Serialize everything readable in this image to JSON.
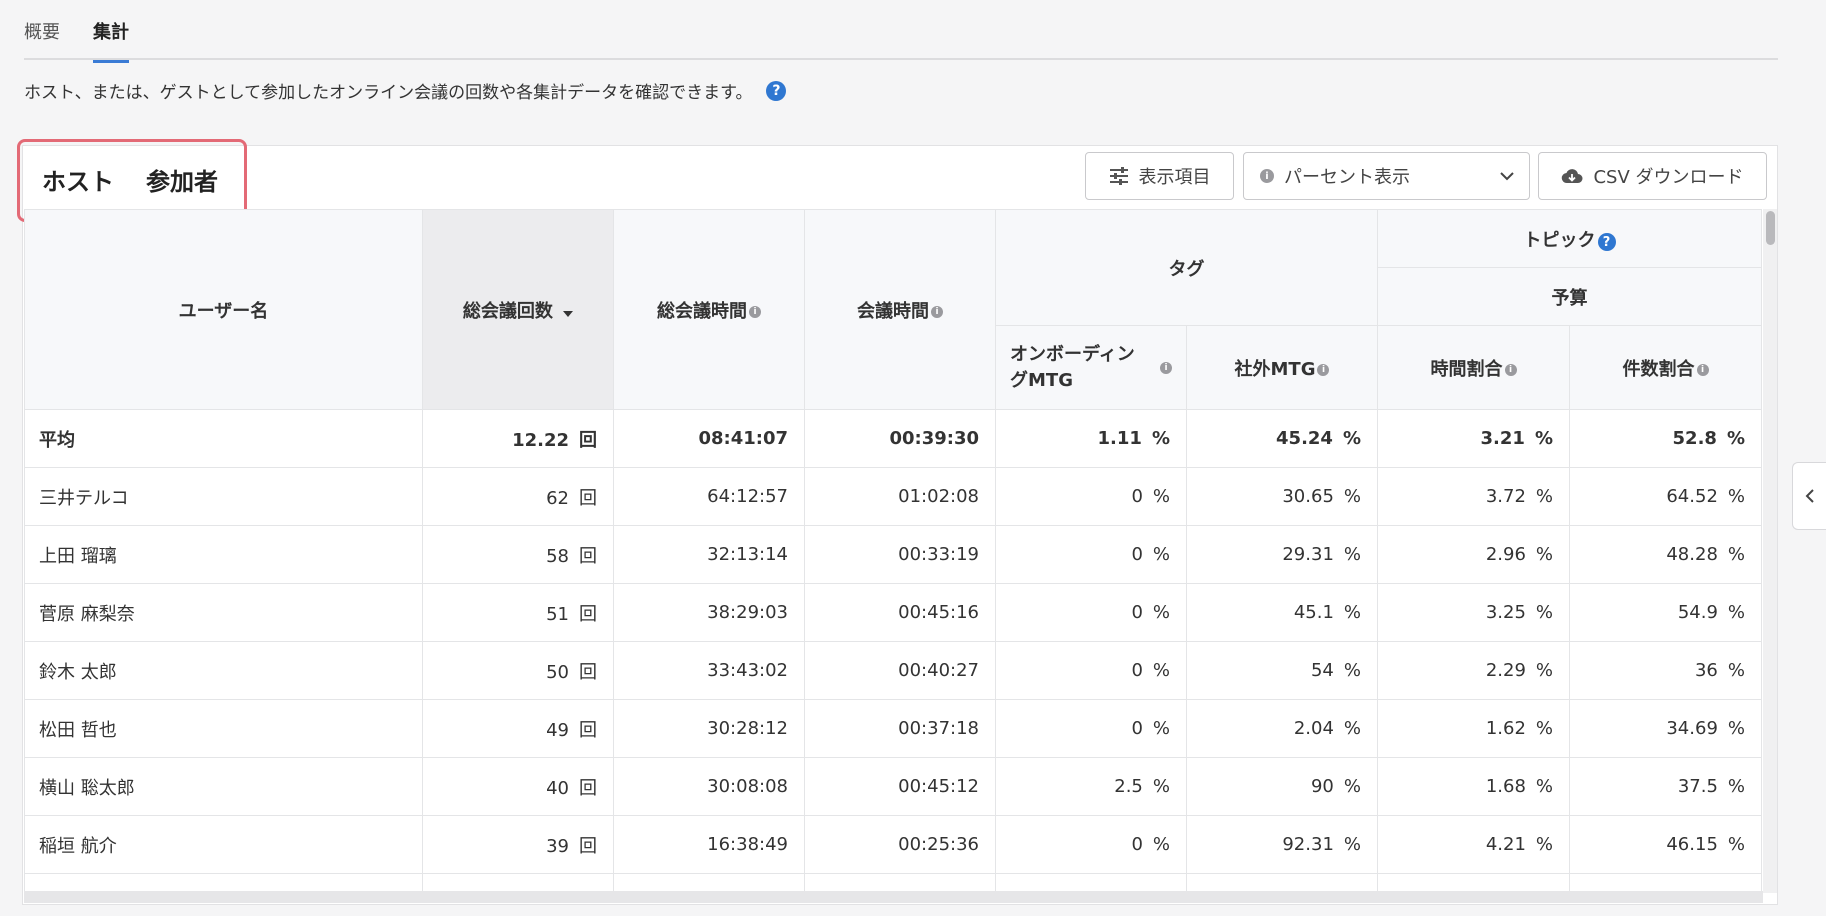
{
  "top_tabs": [
    {
      "label": "概要",
      "active": false
    },
    {
      "label": "集計",
      "active": true
    }
  ],
  "description": "ホスト、または、ゲストとして参加したオンライン会議の回数や各集計データを確認できます。",
  "help_symbol": "?",
  "info_symbol": "i",
  "sub_tabs": [
    {
      "label": "ホスト",
      "active": true
    },
    {
      "label": "参加者",
      "active": false
    }
  ],
  "toolbar": {
    "columns_label": "表示項目",
    "percent_select": "パーセント表示",
    "csv_label": "CSV ダウンロード"
  },
  "table": {
    "headers": {
      "user": "ユーザー名",
      "total_count": "総会議回数",
      "total_time": "総会議時間",
      "meeting_time": "会議時間",
      "tag_group": "タグ",
      "topic_group": "トピック",
      "budget_group": "予算",
      "onboarding": "オンボーディングMTG",
      "external": "社外MTG",
      "time_ratio": "時間割合",
      "count_ratio": "件数割合"
    },
    "count_unit": "回",
    "percent_unit": "%",
    "average": {
      "name": "平均",
      "count": "12.22",
      "total_time": "08:41:07",
      "meeting_time": "00:39:30",
      "onboarding": "1.11",
      "external": "45.24",
      "time_ratio": "3.21",
      "count_ratio": "52.8"
    },
    "rows": [
      {
        "name": "三井テルコ",
        "count": "62",
        "total_time": "64:12:57",
        "meeting_time": "01:02:08",
        "onboarding": "0",
        "external": "30.65",
        "time_ratio": "3.72",
        "count_ratio": "64.52"
      },
      {
        "name": "上田 瑠璃",
        "count": "58",
        "total_time": "32:13:14",
        "meeting_time": "00:33:19",
        "onboarding": "0",
        "external": "29.31",
        "time_ratio": "2.96",
        "count_ratio": "48.28"
      },
      {
        "name": "菅原 麻梨奈",
        "count": "51",
        "total_time": "38:29:03",
        "meeting_time": "00:45:16",
        "onboarding": "0",
        "external": "45.1",
        "time_ratio": "3.25",
        "count_ratio": "54.9"
      },
      {
        "name": "鈴木 太郎",
        "count": "50",
        "total_time": "33:43:02",
        "meeting_time": "00:40:27",
        "onboarding": "0",
        "external": "54",
        "time_ratio": "2.29",
        "count_ratio": "36"
      },
      {
        "name": "松田 哲也",
        "count": "49",
        "total_time": "30:28:12",
        "meeting_time": "00:37:18",
        "onboarding": "0",
        "external": "2.04",
        "time_ratio": "1.62",
        "count_ratio": "34.69"
      },
      {
        "name": "横山 聡太郎",
        "count": "40",
        "total_time": "30:08:08",
        "meeting_time": "00:45:12",
        "onboarding": "2.5",
        "external": "90",
        "time_ratio": "1.68",
        "count_ratio": "37.5"
      },
      {
        "name": "稲垣 航介",
        "count": "39",
        "total_time": "16:38:49",
        "meeting_time": "00:25:36",
        "onboarding": "0",
        "external": "92.31",
        "time_ratio": "4.21",
        "count_ratio": "46.15"
      }
    ]
  }
}
